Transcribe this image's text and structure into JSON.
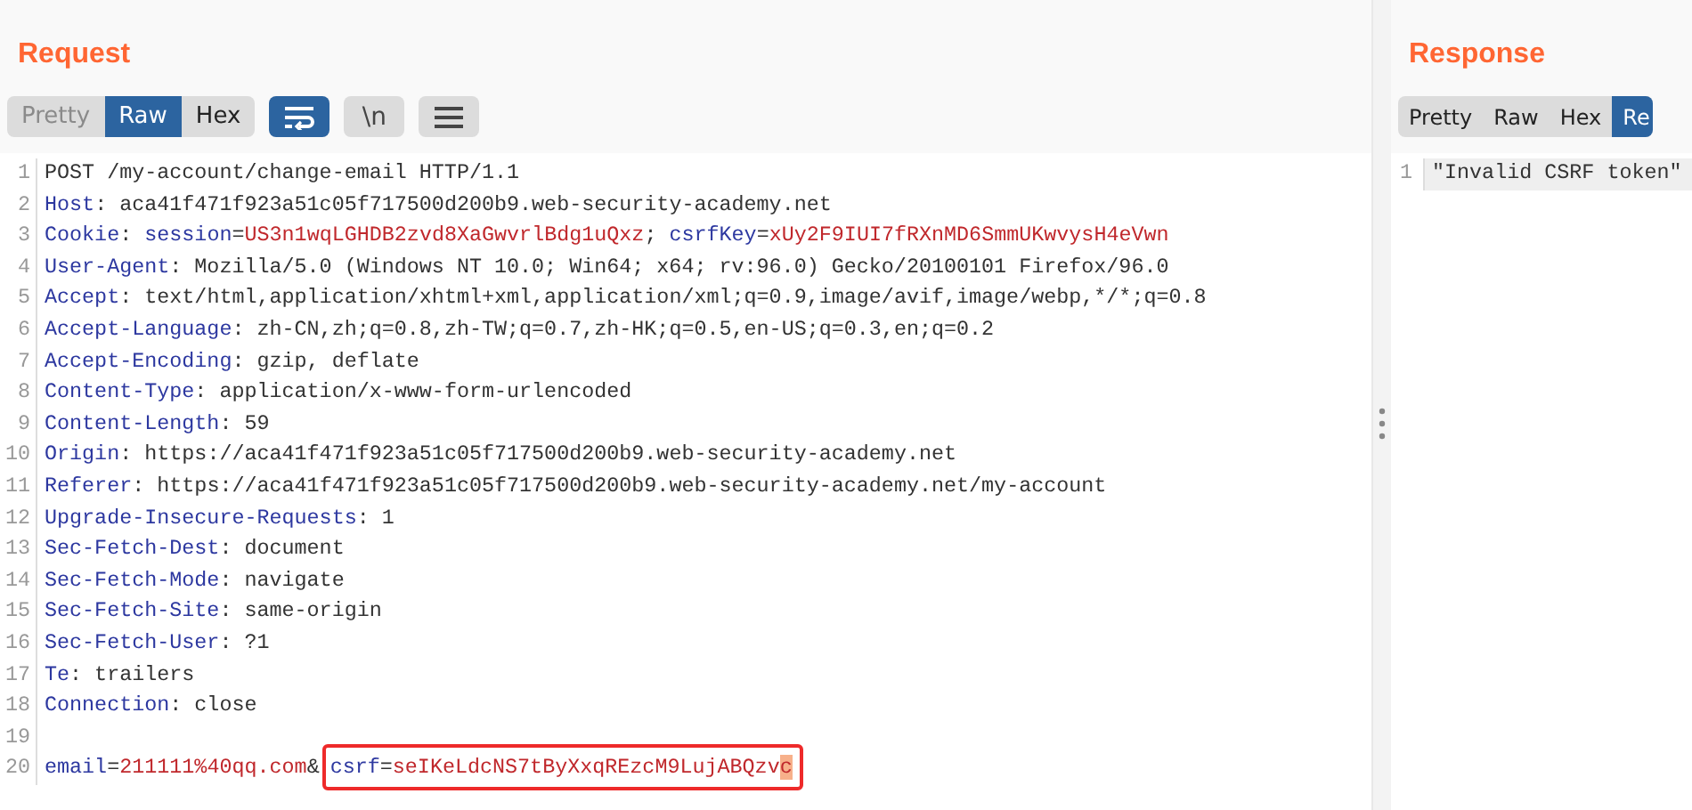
{
  "request": {
    "title": "Request",
    "view_tabs": [
      {
        "label": "Pretty",
        "selected": false,
        "disabled": true
      },
      {
        "label": "Raw",
        "selected": true,
        "disabled": false
      },
      {
        "label": "Hex",
        "selected": false,
        "disabled": false
      }
    ],
    "tool_buttons": [
      {
        "kind": "wrap",
        "on": true
      },
      {
        "kind": "newline",
        "label": "\\n",
        "on": false
      },
      {
        "kind": "menu",
        "on": false
      }
    ],
    "lines": [
      {
        "number": "1",
        "segments": [
          {
            "text": "POST /my-account/change-email HTTP/1.1",
            "kind": "plain"
          }
        ]
      },
      {
        "number": "2",
        "segments": [
          {
            "text": "Host",
            "kind": "name"
          },
          {
            "text": ": aca41f471f923a51c05f717500d200b9.web-security-academy.net",
            "kind": "plain"
          }
        ]
      },
      {
        "number": "3",
        "segments": [
          {
            "text": "Cookie",
            "kind": "name"
          },
          {
            "text": ": ",
            "kind": "plain"
          },
          {
            "text": "session",
            "kind": "name"
          },
          {
            "text": "=",
            "kind": "plain"
          },
          {
            "text": "US3n1wqLGHDB2zvd8XaGwvrlBdg1uQxz",
            "kind": "value"
          },
          {
            "text": "; ",
            "kind": "plain"
          },
          {
            "text": "csrfKey",
            "kind": "name"
          },
          {
            "text": "=",
            "kind": "plain"
          },
          {
            "text": "xUy2F9IUI7fRXnMD6SmmUKwvysH4eVwn",
            "kind": "value"
          }
        ]
      },
      {
        "number": "4",
        "segments": [
          {
            "text": "User-Agent",
            "kind": "name"
          },
          {
            "text": ": Mozilla/5.0 (Windows NT 10.0; Win64; x64; rv:96.0) Gecko/20100101 Firefox/96.0",
            "kind": "plain"
          }
        ]
      },
      {
        "number": "5",
        "segments": [
          {
            "text": "Accept",
            "kind": "name"
          },
          {
            "text": ": text/html,application/xhtml+xml,application/xml;q=0.9,image/avif,image/webp,*/*;q=0.8",
            "kind": "plain"
          }
        ]
      },
      {
        "number": "6",
        "segments": [
          {
            "text": "Accept-Language",
            "kind": "name"
          },
          {
            "text": ": zh-CN,zh;q=0.8,zh-TW;q=0.7,zh-HK;q=0.5,en-US;q=0.3,en;q=0.2",
            "kind": "plain"
          }
        ]
      },
      {
        "number": "7",
        "segments": [
          {
            "text": "Accept-Encoding",
            "kind": "name"
          },
          {
            "text": ": gzip, deflate",
            "kind": "plain"
          }
        ]
      },
      {
        "number": "8",
        "segments": [
          {
            "text": "Content-Type",
            "kind": "name"
          },
          {
            "text": ": application/x-www-form-urlencoded",
            "kind": "plain"
          }
        ]
      },
      {
        "number": "9",
        "segments": [
          {
            "text": "Content-Length",
            "kind": "name"
          },
          {
            "text": ": 59",
            "kind": "plain"
          }
        ]
      },
      {
        "number": "10",
        "segments": [
          {
            "text": "Origin",
            "kind": "name"
          },
          {
            "text": ": https://aca41f471f923a51c05f717500d200b9.web-security-academy.net",
            "kind": "plain"
          }
        ]
      },
      {
        "number": "11",
        "segments": [
          {
            "text": "Referer",
            "kind": "name"
          },
          {
            "text": ": https://aca41f471f923a51c05f717500d200b9.web-security-academy.net/my-account",
            "kind": "plain"
          }
        ]
      },
      {
        "number": "12",
        "segments": [
          {
            "text": "Upgrade-Insecure-Requests",
            "kind": "name"
          },
          {
            "text": ": 1",
            "kind": "plain"
          }
        ]
      },
      {
        "number": "13",
        "segments": [
          {
            "text": "Sec-Fetch-Dest",
            "kind": "name"
          },
          {
            "text": ": document",
            "kind": "plain"
          }
        ]
      },
      {
        "number": "14",
        "segments": [
          {
            "text": "Sec-Fetch-Mode",
            "kind": "name"
          },
          {
            "text": ": navigate",
            "kind": "plain"
          }
        ]
      },
      {
        "number": "15",
        "segments": [
          {
            "text": "Sec-Fetch-Site",
            "kind": "name"
          },
          {
            "text": ": same-origin",
            "kind": "plain"
          }
        ]
      },
      {
        "number": "16",
        "segments": [
          {
            "text": "Sec-Fetch-User",
            "kind": "name"
          },
          {
            "text": ": ?1",
            "kind": "plain"
          }
        ]
      },
      {
        "number": "17",
        "segments": [
          {
            "text": "Te",
            "kind": "name"
          },
          {
            "text": ": trailers",
            "kind": "plain"
          }
        ]
      },
      {
        "number": "18",
        "segments": [
          {
            "text": "Connection",
            "kind": "name"
          },
          {
            "text": ": close",
            "kind": "plain"
          }
        ]
      },
      {
        "number": "19"
      },
      {
        "number": "20",
        "segments": [
          {
            "text": "email",
            "kind": "name"
          },
          {
            "text": "=",
            "kind": "plain"
          },
          {
            "text": "211111%40qq.com",
            "kind": "value"
          },
          {
            "text": "&",
            "kind": "plain"
          }
        ],
        "boxed_segments": [
          {
            "text": "csrf",
            "kind": "name"
          },
          {
            "text": "=",
            "kind": "plain"
          },
          {
            "text": "seIKeLdcNS7tByXxqREzcM9LujABQzv",
            "kind": "value"
          },
          {
            "text": "c",
            "kind": "selected"
          }
        ]
      }
    ]
  },
  "response": {
    "title": "Response",
    "view_tabs": [
      {
        "label": "Pretty",
        "selected": false,
        "disabled": false
      },
      {
        "label": "Raw",
        "selected": false,
        "disabled": false
      },
      {
        "label": "Hex",
        "selected": false,
        "disabled": false
      },
      {
        "label": "Re",
        "selected": true,
        "disabled": false
      }
    ],
    "lines": [
      {
        "number": "1",
        "segments": [
          {
            "text": "\"Invalid CSRF token\"",
            "kind": "plain"
          }
        ],
        "current": true
      }
    ]
  }
}
